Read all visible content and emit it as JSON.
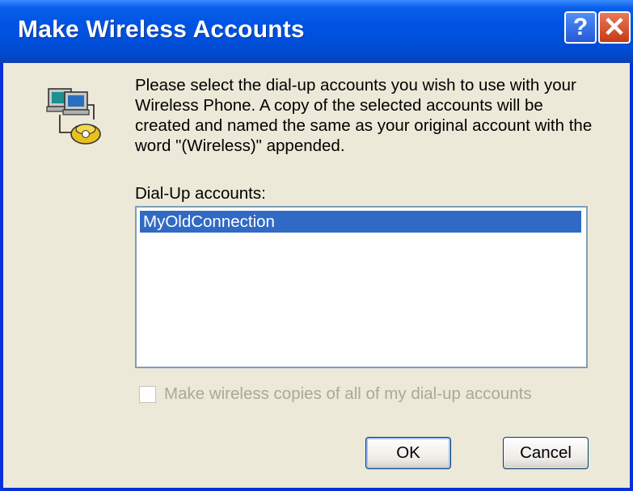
{
  "window": {
    "title": "Make Wireless Accounts",
    "help_button": "?",
    "close_button": "✕"
  },
  "message": {
    "line1": "Please select the dial-up accounts you wish to use with your",
    "line2": "Wireless Phone.  A copy of the selected accounts will be",
    "line3": "created and named the same as your original account with the",
    "line4": "word \"(Wireless)\" appended."
  },
  "accounts": {
    "label": "Dial-Up accounts:",
    "items": [
      "MyOldConnection"
    ],
    "selected": "MyOldConnection"
  },
  "option": {
    "label": "Make wireless copies of all of my dial-up accounts",
    "checked": false,
    "enabled": false
  },
  "buttons": {
    "ok": "OK",
    "cancel": "Cancel"
  },
  "icons": {
    "dialup": "dial-up-networking-icon"
  },
  "colors": {
    "titlebar": "#0054e3",
    "selection": "#316ac5",
    "dialog_bg": "#ece9d8",
    "disabled_text": "#aca899"
  }
}
